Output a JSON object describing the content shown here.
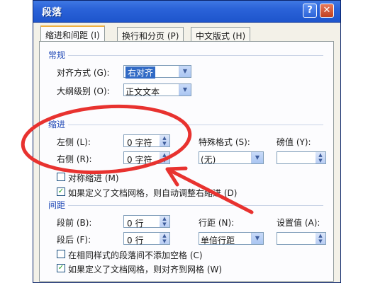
{
  "window": {
    "title": "段落",
    "help_glyph": "?",
    "close_glyph": "✕"
  },
  "tabs": [
    {
      "label": "缩进和间距 (I)",
      "active": true
    },
    {
      "label": "换行和分页 (P)",
      "active": false
    },
    {
      "label": "中文版式 (H)",
      "active": false
    }
  ],
  "general": {
    "section_title": "常规",
    "alignment_label": "对齐方式 (G):",
    "alignment_value": "右对齐",
    "outline_label": "大纲级别 (O):",
    "outline_value": "正文文本"
  },
  "indent": {
    "section_title": "缩进",
    "left_label": "左侧 (L):",
    "left_value": "0 字符",
    "right_label": "右侧 (R):",
    "right_value": "0 字符",
    "special_label": "特殊格式 (S):",
    "special_value": "(无)",
    "by_label": "磅值 (Y):",
    "by_value": "",
    "mirror_label": "对称缩进 (M)",
    "mirror_checked": false,
    "grid_label": "如果定义了文档网格，则自动调整右缩进 (D)",
    "grid_checked": true
  },
  "spacing": {
    "section_title": "间距",
    "before_label": "段前 (B):",
    "before_value": "0 行",
    "after_label": "段后 (F):",
    "after_value": "0 行",
    "line_label": "行距 (N):",
    "line_value": "单倍行距",
    "at_label": "设置值 (A):",
    "at_value": "",
    "nospace_label": "在相同样式的段落间不添加空格 (C)",
    "nospace_checked": false,
    "snap_label": "如果定义了文档网格，则对齐到网格 (W)",
    "snap_checked": true
  },
  "icons": {
    "dropdown": "chevron-down-icon",
    "spinner": "spin-arrows-icon",
    "check": "checkmark-icon"
  },
  "colors": {
    "titlebar": "#2a62d8",
    "section_text": "#2149b6",
    "annotation": "#e8322f"
  }
}
